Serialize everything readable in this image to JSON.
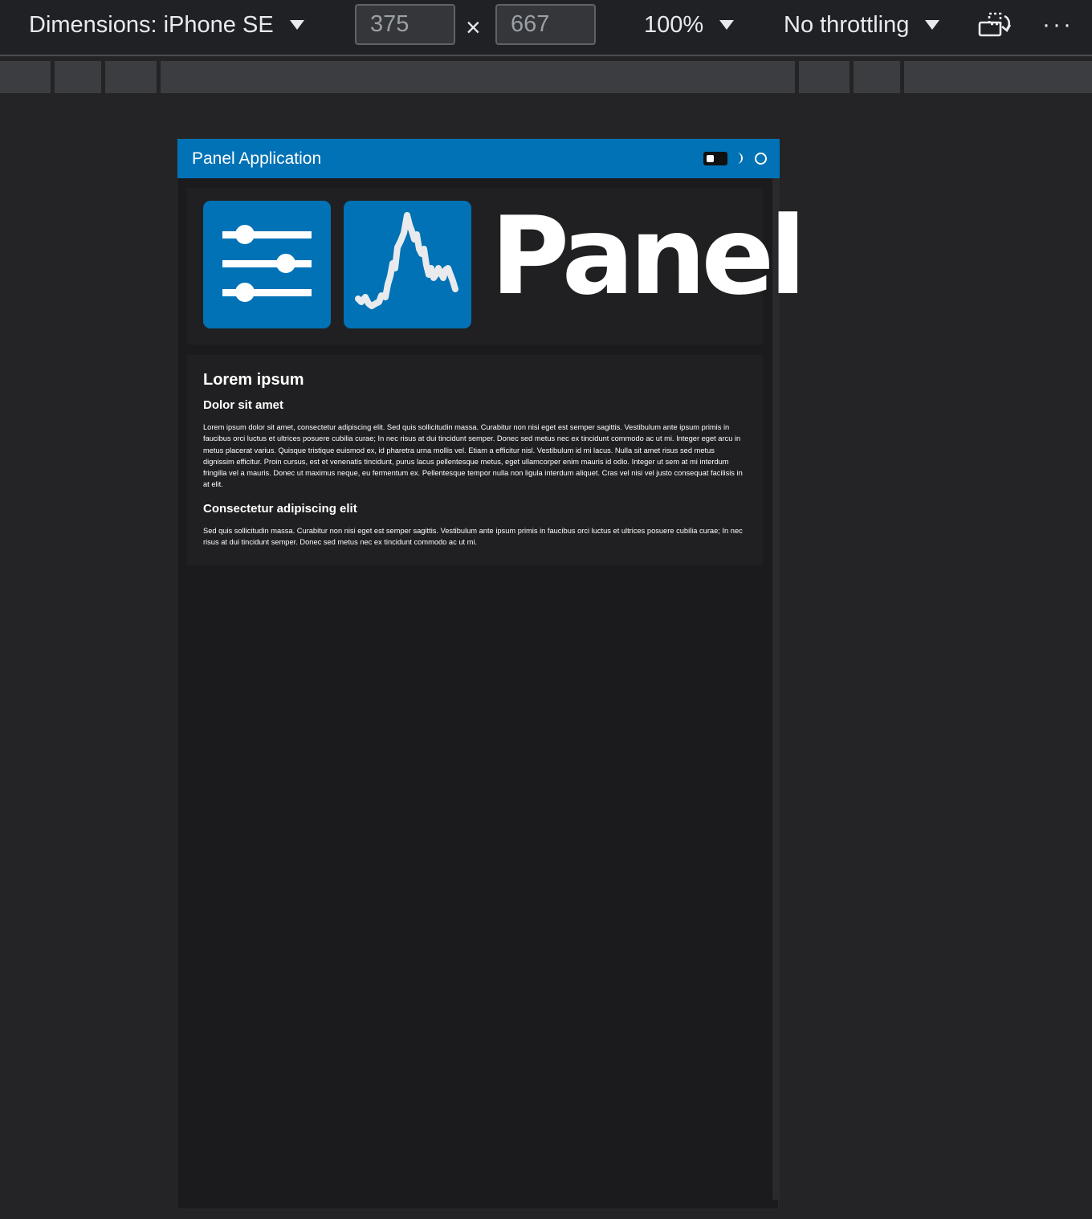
{
  "devtools_toolbar": {
    "dimensions_label": "Dimensions: iPhone SE",
    "width_value": "375",
    "times_symbol": "×",
    "height_value": "667",
    "zoom_label": "100%",
    "throttling_label": "No throttling",
    "rotate_icon": "rotate-icon",
    "more_icon": "more-options-icon",
    "more_symbol": "···"
  },
  "app": {
    "title": "Panel Application",
    "header_color": "#0072b5",
    "header_icons": [
      "theme-toggle-icon",
      "moon-icon",
      "circle-icon"
    ]
  },
  "logo": {
    "wordmark": "Panel",
    "icons": [
      "sliders-icon",
      "line-chart-icon"
    ]
  },
  "content": {
    "heading": "Lorem ipsum",
    "section1_title": "Dolor sit amet",
    "section1_body": "Lorem ipsum dolor sit amet, consectetur adipiscing elit. Sed quis sollicitudin massa. Curabitur non nisi eget est semper sagittis. Vestibulum ante ipsum primis in faucibus orci luctus et ultrices posuere cubilia curae; In nec risus at dui tincidunt semper. Donec sed metus nec ex tincidunt commodo ac ut mi. Integer eget arcu in metus placerat varius. Quisque tristique euismod ex, id pharetra urna mollis vel. Etiam a efficitur nisl. Vestibulum id mi lacus. Nulla sit amet risus sed metus dignissim efficitur. Proin cursus, est et venenatis tincidunt, purus lacus pellentesque metus, eget ullamcorper enim mauris id odio. Integer ut sem at mi interdum fringilla vel a mauris. Donec ut maximus neque, eu fermentum ex. Pellentesque tempor nulla non ligula interdum aliquet. Cras vel nisi vel justo consequat facilisis in at elit.",
    "section2_title": "Consectetur adipiscing elit",
    "section2_body": "Sed quis sollicitudin massa. Curabitur non nisi eget est semper sagittis. Vestibulum ante ipsum primis in faucibus orci luctus et ultrices posuere cubilia curae; In nec risus at dui tincidunt semper. Donec sed metus nec ex tincidunt commodo ac ut mi."
  }
}
